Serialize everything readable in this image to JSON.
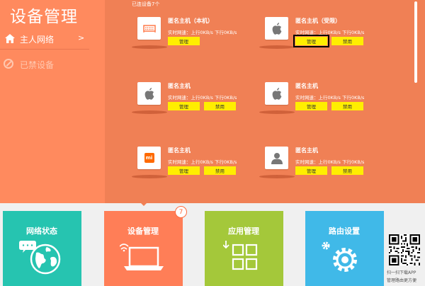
{
  "sidebar": {
    "title": "设备管理",
    "items": [
      {
        "label": "主人网络",
        "arrow": ">"
      },
      {
        "label": "已禁设备"
      }
    ]
  },
  "main": {
    "connected_count": "已连设备7个",
    "devices": [
      {
        "icon": "router-icon",
        "name": "匿名主机（本机）",
        "speed": "实时网速：上行0KB/s  下行0KB/s",
        "manage": "管理",
        "ban": null
      },
      {
        "icon": "apple-icon",
        "name": "匿名主机（受限）",
        "speed": "实时网速：上行0KB/s  下行0KB/s",
        "manage": "管理",
        "ban": "禁用"
      },
      {
        "icon": "apple-icon",
        "name": "匿名主机",
        "speed": "实时网速：上行0KB/s  下行0KB/s",
        "manage": "管理",
        "ban": "禁用"
      },
      {
        "icon": "apple-icon",
        "name": "匿名主机",
        "speed": "实时网速：上行0KB/s  下行0KB/s",
        "manage": "管理",
        "ban": "禁用"
      },
      {
        "icon": "xiaomi-icon",
        "name": "匿名主机",
        "speed": "实时网速：上行0KB/s  下行0KB/s",
        "manage": "管理",
        "ban": "禁用"
      },
      {
        "icon": "person-icon",
        "name": "匿名主机",
        "speed": "实时网速：上行0KB/s  下行0KB/s",
        "manage": "管理",
        "ban": "禁用"
      }
    ],
    "xiaomi_logo": "mi"
  },
  "tiles": [
    {
      "label": "网络状态",
      "icon": "globe-icon",
      "color": "#26c4b0"
    },
    {
      "label": "设备管理",
      "icon": "laptop-icon",
      "color": "#ff7e57",
      "badge": "7"
    },
    {
      "label": "应用管理",
      "icon": "apps-grid-icon",
      "color": "#a4c83a"
    },
    {
      "label": "路由设置",
      "icon": "gear-icon",
      "color": "#40b9e8"
    }
  ],
  "qr": {
    "line1": "扫一扫下载APP",
    "line2": "管理路由更方便"
  },
  "colors": {
    "sidebar_bg": "#ff8a5e",
    "main_bg": "#f08055",
    "button_yellow": "#ffee00"
  }
}
